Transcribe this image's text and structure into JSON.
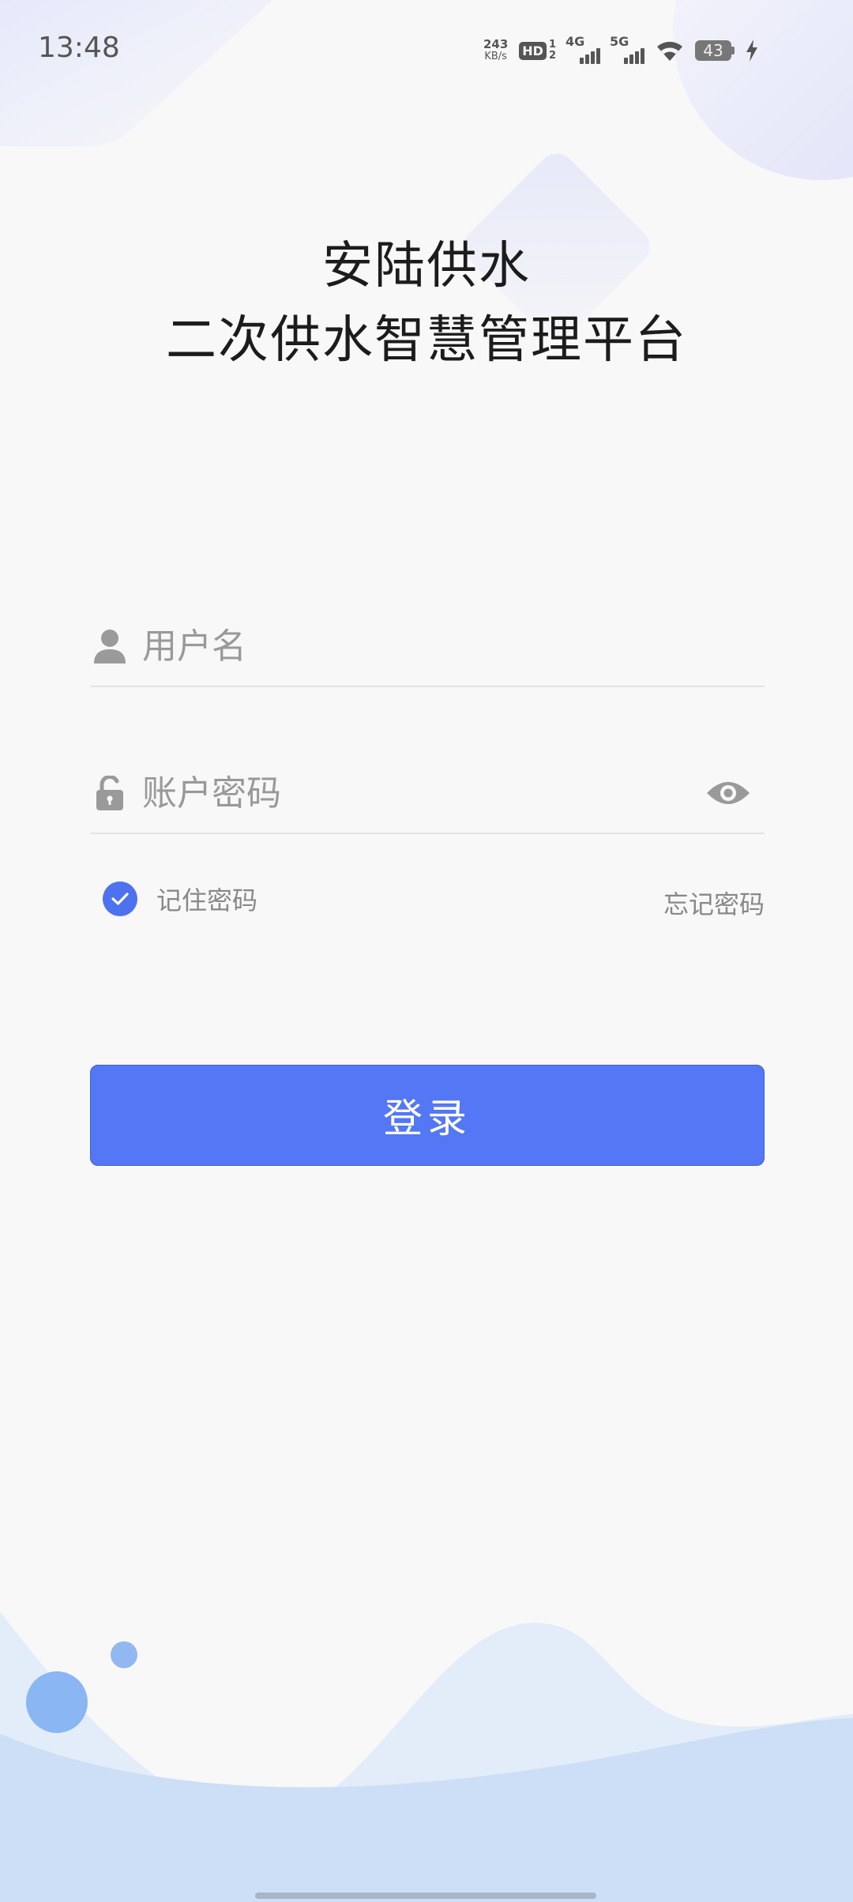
{
  "status_bar": {
    "time": "13:48",
    "net_speed_value": "243",
    "net_speed_unit": "KB/s",
    "hd_label": "HD",
    "sim_top": "1",
    "sim_bottom": "2",
    "signal_1_type": "4G",
    "signal_2_type": "5G",
    "battery_level": "43",
    "icons": [
      "hd-icon",
      "signal-4g-icon",
      "signal-5g-icon",
      "wifi-icon",
      "battery-icon",
      "charging-icon"
    ]
  },
  "header": {
    "title_line1": "安陆供水",
    "title_line2": "二次供水智慧管理平台"
  },
  "login_form": {
    "username_placeholder": "用户名",
    "password_placeholder": "账户密码",
    "remember_label": "记住密码",
    "remember_checked": true,
    "forgot_label": "忘记密码",
    "submit_label": "登录"
  },
  "colors": {
    "accent": "#5377f5",
    "background": "#f8f8f8",
    "wave_light": "#e3ecf9",
    "wave_dark": "#cddff6"
  }
}
